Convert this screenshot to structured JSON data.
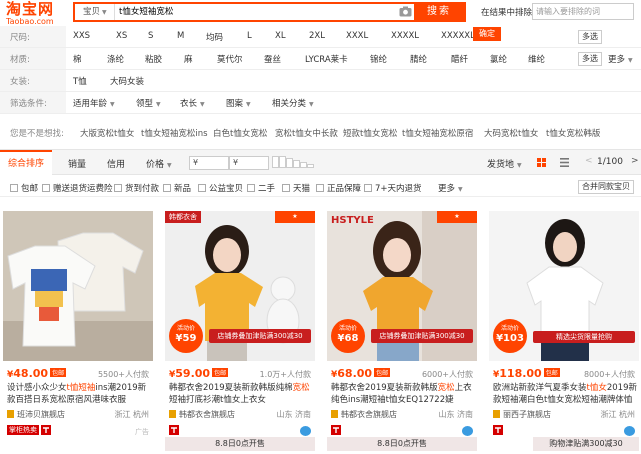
{
  "header": {
    "logo_cn": "淘宝网",
    "logo_en": "Taobao.com",
    "scope": "宝贝",
    "query": "t恤女短袖宽松",
    "search_button": "搜索",
    "in_results_label": "在结果中排除",
    "in_results_placeholder": "请输入要排除的词"
  },
  "filters": {
    "size": {
      "label": "尺码:",
      "options": [
        "XXS",
        "XS",
        "S",
        "M",
        "均码",
        "L",
        "XL",
        "2XL",
        "XXXL",
        "XXXXL",
        "XXXXXL"
      ],
      "multi": "多选",
      "confirm": "确定"
    },
    "material": {
      "label": "材质:",
      "options": [
        "棉",
        "涤纶",
        "粘胶",
        "麻",
        "莫代尔",
        "蚕丝",
        "LYCRA莱卡",
        "锦纶",
        "腈纶",
        "醋纤",
        "氯纶",
        "维纶"
      ],
      "multi": "多选",
      "more": "更多"
    },
    "women": {
      "label": "女装:",
      "options": [
        "T恤",
        "大码女装"
      ]
    },
    "conditions": {
      "label": "筛选条件:",
      "options": [
        "适用年龄",
        "领型",
        "衣长",
        "图案",
        "相关分类"
      ]
    },
    "related": {
      "label": "您是不是想找:",
      "options": [
        "大版宽松t恤女",
        "t恤女短袖宽松ins",
        "白色t恤女宽松",
        "宽松t恤女中长款",
        "短款t恤女宽松",
        "t恤女短袖宽松原宿",
        "大码宽松t恤女",
        "t恤女宽松韩版"
      ]
    }
  },
  "sortbar": {
    "tabs": [
      "综合排序",
      "销量",
      "信用",
      "价格"
    ],
    "price_from": "¥",
    "price_to": "¥",
    "ship_from": "发货地",
    "page": "1/100"
  },
  "checkboxes": [
    "包邮",
    "赠送退货运费险",
    "货到付款",
    "新品",
    "公益宝贝",
    "二手",
    "天猫",
    "正品保障",
    "7+天内退货"
  ],
  "checkbox_more": "更多",
  "merge_shop": "合并同款宝贝",
  "products": [
    {
      "price": "48.00",
      "baoyou": "包邮",
      "sales": "5500+人付款",
      "title_pre": "设计感小众少女",
      "title_hl": "t恤短袖",
      "title_post": "ins潮2019新款百搭日系宽松原宿风港味衣服",
      "shop": "班沛贝旗舰店",
      "loc": "浙江 杭州",
      "badge": "掌柜热卖"
    },
    {
      "price": "59.00",
      "baoyou": "包邮",
      "sales": "1.0万+人付款",
      "title_pre": "韩都衣舍2019夏装新款韩版纯棉",
      "title_hl": "宽松",
      "title_post": "短袖打底衫潮t恤女上衣女",
      "shop": "韩都衣舍旗舰店",
      "loc": "山东 济南",
      "corner": "韩都衣舍",
      "pb_top": "活动价",
      "pb_val": "59",
      "promo": "店铺券叠加津贴满300减30",
      "date": "8.8日0点开售"
    },
    {
      "price": "68.00",
      "baoyou": "包邮",
      "sales": "6000+人付款",
      "title_pre": "韩都衣舍2019夏装新款韩版",
      "title_hl": "宽松",
      "title_post": "上衣纯色ins潮短袖t恤女EQ12722婕",
      "shop": "韩都衣舍旗舰店",
      "loc": "山东 济南",
      "corner": "HSTYLE",
      "pb_top": "活动价",
      "pb_val": "68",
      "promo": "店铺券叠加津贴满300减30",
      "date": "8.8日0点开售"
    },
    {
      "price": "118.00",
      "baoyou": "包邮",
      "sales": "8000+人付款",
      "title_pre": "欧洲站新款洋气夏季女装",
      "title_hl": "t恤女",
      "title_post": "2019新款短袖潮白色t恤女宽松短袖潮牌体恤",
      "shop": "丽西子旗舰店",
      "loc": "浙江 杭州",
      "pb_top": "活动价",
      "pb_val": "103",
      "promo": "精选尖货限量抢购",
      "date": "购物津贴满300减30"
    }
  ],
  "colors": {
    "accent": "#ff4400"
  }
}
